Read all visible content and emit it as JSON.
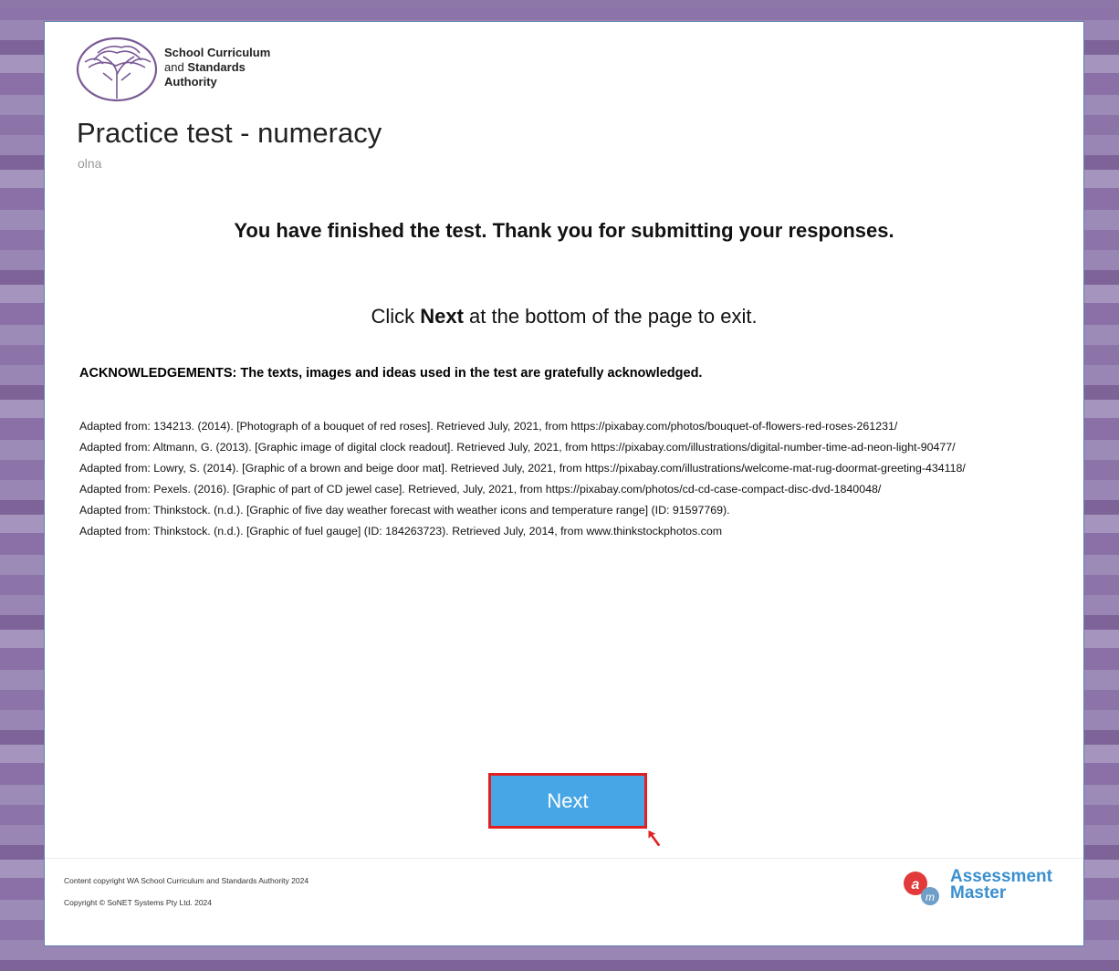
{
  "header": {
    "logo_line1": "School Curriculum",
    "logo_line2_prefix": "and ",
    "logo_line2_bold": "Standards",
    "logo_line3": "Authority",
    "title": "Practice test - numeracy",
    "subtitle": "olna"
  },
  "main": {
    "finished_message": "You have finished the test. Thank you for submitting your responses.",
    "instruction_prefix": "Click ",
    "instruction_bold": "Next",
    "instruction_suffix": " at the bottom of the page to exit.",
    "acknowledgements_heading": "ACKNOWLEDGEMENTS: The texts, images and ideas used in the test are gratefully acknowledged.",
    "acknowledgements": [
      "Adapted from: 134213. (2014). [Photograph of a bouquet of red roses]. Retrieved July, 2021, from https://pixabay.com/photos/bouquet-of-flowers-red-roses-261231/",
      "Adapted from: Altmann, G. (2013). [Graphic image of digital clock readout]. Retrieved July, 2021, from https://pixabay.com/illustrations/digital-number-time-ad-neon-light-90477/",
      "Adapted from: Lowry, S. (2014). [Graphic of a brown and beige door mat]. Retrieved July, 2021, from https://pixabay.com/illustrations/welcome-mat-rug-doormat-greeting-434118/",
      "Adapted from: Pexels. (2016). [Graphic of part of CD jewel case]. Retrieved, July, 2021, from https://pixabay.com/photos/cd-cd-case-compact-disc-dvd-1840048/",
      "Adapted from: Thinkstock. (n.d.). [Graphic of five day weather forecast with weather icons and temperature range] (ID: 91597769).",
      "Adapted from: Thinkstock. (n.d.). [Graphic of fuel gauge] (ID: 184263723). Retrieved July, 2014, from www.thinkstockphotos.com"
    ],
    "next_label": "Next"
  },
  "footer": {
    "copyright_line1": "Content copyright WA School Curriculum and Standards Authority 2024",
    "copyright_line2": "Copyright © SoNET Systems Pty Ltd. 2024",
    "brand_line1": "Assessment",
    "brand_line2": "Master"
  },
  "colors": {
    "button_bg": "#47a6e6",
    "button_border": "#e22020",
    "brand_blue": "#3b8fcf",
    "brand_red": "#e23a3a",
    "logo_purple": "#7a5a96"
  },
  "icons": [
    "scsa-tree-logo-icon",
    "assessment-master-logo-icon",
    "mouse-cursor-icon"
  ]
}
